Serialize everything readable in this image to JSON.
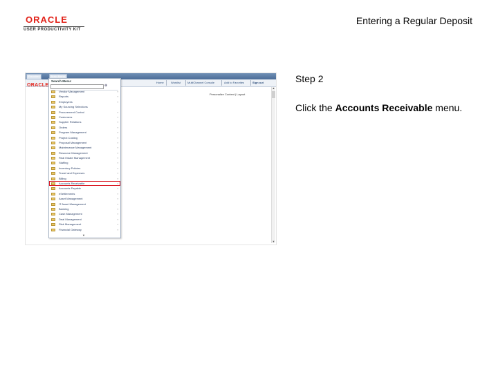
{
  "header": {
    "logo_oracle": "ORACLE",
    "logo_upk": "USER PRODUCTIVITY KIT",
    "doc_title": "Entering a Regular Deposit"
  },
  "instructions": {
    "step": "Step 2",
    "text_before": "Click the ",
    "text_bold": "Accounts Receivable",
    "text_after": " menu."
  },
  "app": {
    "breadcrumb_1": "Favorites",
    "breadcrumb_2": "Main Menu",
    "brand": "ORACLE",
    "nav": [
      "Home",
      "Worklist",
      "MultiChannel Console",
      "Add to Favorites",
      "Sign out"
    ],
    "personalize": "Personalize Content | Layout",
    "menu": {
      "title": "Search Menu:",
      "search_placeholder": "",
      "items": [
        {
          "label": "Vendor Management",
          "arrow": true
        },
        {
          "label": "Reports",
          "arrow": true
        },
        {
          "label": "Employees",
          "arrow": true
        },
        {
          "label": "My Sourcing Selections",
          "arrow": false
        },
        {
          "label": "Procurement Control",
          "arrow": true
        },
        {
          "label": "Customers",
          "arrow": true
        },
        {
          "label": "Supplier Relations",
          "arrow": true
        },
        {
          "label": "Orders",
          "arrow": true
        },
        {
          "label": "Program Management",
          "arrow": true
        },
        {
          "label": "Project Costing",
          "arrow": true
        },
        {
          "label": "Proposal Management",
          "arrow": true
        },
        {
          "label": "Maintenance Management",
          "arrow": true
        },
        {
          "label": "Resource Management",
          "arrow": true
        },
        {
          "label": "Real Estate Management",
          "arrow": true
        },
        {
          "label": "Staffing",
          "arrow": true
        },
        {
          "label": "Inventory Policies",
          "arrow": true
        },
        {
          "label": "Travel and Expenses",
          "arrow": true
        },
        {
          "label": "Billing",
          "arrow": true
        },
        {
          "label": "Accounts Receivable",
          "arrow": true,
          "highlighted": true
        },
        {
          "label": "Accounts Payable",
          "arrow": true
        },
        {
          "label": "eSettlements",
          "arrow": true
        },
        {
          "label": "Asset Management",
          "arrow": true
        },
        {
          "label": "IT Asset Management",
          "arrow": true
        },
        {
          "label": "Banking",
          "arrow": true
        },
        {
          "label": "Cash Management",
          "arrow": true
        },
        {
          "label": "Deal Management",
          "arrow": true
        },
        {
          "label": "Risk Management",
          "arrow": true
        },
        {
          "label": "Financial Gateway",
          "arrow": true
        }
      ],
      "more_indicator": "▼"
    }
  },
  "colors": {
    "highlight": "#d9121d",
    "oracle_red": "#e2231a",
    "link_blue": "#2a4c7a"
  }
}
